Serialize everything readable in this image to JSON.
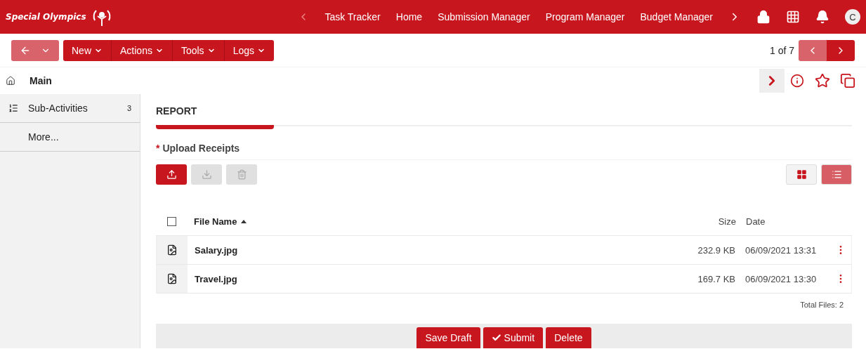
{
  "brand": {
    "name": "Special Olympics"
  },
  "nav": {
    "items": [
      "Task Tracker",
      "Home",
      "Submission Manager",
      "Program Manager",
      "Budget Manager"
    ],
    "user_initial": "C"
  },
  "toolbar": {
    "back_disabled": true,
    "menus": [
      "New",
      "Actions",
      "Tools",
      "Logs"
    ],
    "pager": "1 of 7",
    "prev_disabled": true,
    "next_disabled": false
  },
  "breadcrumb": "Main",
  "sidebar": {
    "items": [
      {
        "label": "Sub-Activities",
        "count": "3",
        "kind": "list"
      },
      {
        "label": "More...",
        "kind": "plain"
      }
    ]
  },
  "section": {
    "title": "REPORT"
  },
  "upload": {
    "label": "Upload Receipts",
    "required_mark": "*",
    "actions": [
      {
        "kind": "upload",
        "disabled": false
      },
      {
        "kind": "download",
        "disabled": true
      },
      {
        "kind": "delete",
        "disabled": true
      }
    ],
    "views": [
      {
        "kind": "grid",
        "selected": false
      },
      {
        "kind": "list",
        "selected": true
      }
    ],
    "columns": {
      "name": "File Name",
      "size": "Size",
      "date": "Date"
    },
    "select_all_checked": false,
    "files": [
      {
        "name": "Salary.jpg",
        "size": "232.9 KB",
        "date": "06/09/2021 13:31"
      },
      {
        "name": "Travel.jpg",
        "size": "169.7 KB",
        "date": "06/09/2021 13:30"
      }
    ],
    "total": "Total Files: 2"
  },
  "footer": {
    "buttons": [
      {
        "kind": "save",
        "label": "Save Draft"
      },
      {
        "kind": "submit",
        "label": "Submit"
      },
      {
        "kind": "delete",
        "label": "Delete"
      }
    ]
  }
}
